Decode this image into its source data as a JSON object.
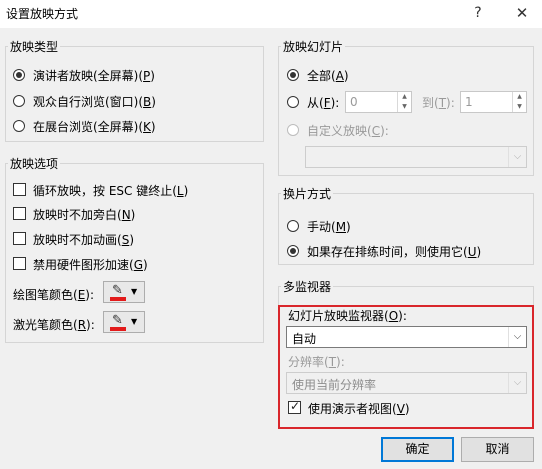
{
  "window": {
    "title": "设置放映方式",
    "help_label": "?",
    "close_label": "✕"
  },
  "show_type": {
    "title": "放映类型",
    "options": [
      {
        "label": "演讲者放映(全屏幕)(",
        "key": "P",
        "after": ")",
        "checked": true
      },
      {
        "label": "观众自行浏览(窗口)(",
        "key": "B",
        "after": ")",
        "checked": false
      },
      {
        "label": "在展台浏览(全屏幕)(",
        "key": "K",
        "after": ")",
        "checked": false
      }
    ]
  },
  "show_options": {
    "title": "放映选项",
    "checks": [
      {
        "label": "循环放映，按 ESC 键终止(",
        "key": "L",
        "after": ")",
        "checked": false
      },
      {
        "label": "放映时不加旁白(",
        "key": "N",
        "after": ")",
        "checked": false
      },
      {
        "label": "放映时不加动画(",
        "key": "S",
        "after": ")",
        "checked": false
      },
      {
        "label": "禁用硬件图形加速(",
        "key": "G",
        "after": ")",
        "checked": false
      }
    ],
    "pen_color": {
      "label": "绘图笔颜色(",
      "key": "E",
      "after": "):",
      "color": "#e31b1b"
    },
    "laser_color": {
      "label": "激光笔颜色(",
      "key": "R",
      "after": "):",
      "color": "#e31b1b"
    }
  },
  "slides": {
    "title": "放映幻灯片",
    "all": {
      "label": "全部(",
      "key": "A",
      "after": ")",
      "checked": true
    },
    "from": {
      "label": "从(",
      "key": "F",
      "after": "):",
      "value": "0",
      "checked": false
    },
    "to": {
      "label": "到(",
      "key": "T",
      "after": "):",
      "value": "1"
    },
    "custom": {
      "label": "自定义放映(",
      "key": "C",
      "after": "):",
      "value": ""
    }
  },
  "advance": {
    "title": "换片方式",
    "manual": {
      "label": "手动(",
      "key": "M",
      "after": ")",
      "checked": false
    },
    "timings": {
      "label": "如果存在排练时间，则使用它(",
      "key": "U",
      "after": ")",
      "checked": true
    }
  },
  "monitors": {
    "title": "多监视器",
    "monitor": {
      "label": "幻灯片放映监视器(",
      "key": "O",
      "after": "):",
      "value": "自动"
    },
    "resolution": {
      "label": "分辨率(",
      "key": "T",
      "after": "):",
      "value": "使用当前分辨率"
    },
    "presenter_view": {
      "label": "使用演示者视图(",
      "key": "V",
      "after": ")",
      "checked": true
    }
  },
  "buttons": {
    "ok": "确定",
    "cancel": "取消"
  }
}
